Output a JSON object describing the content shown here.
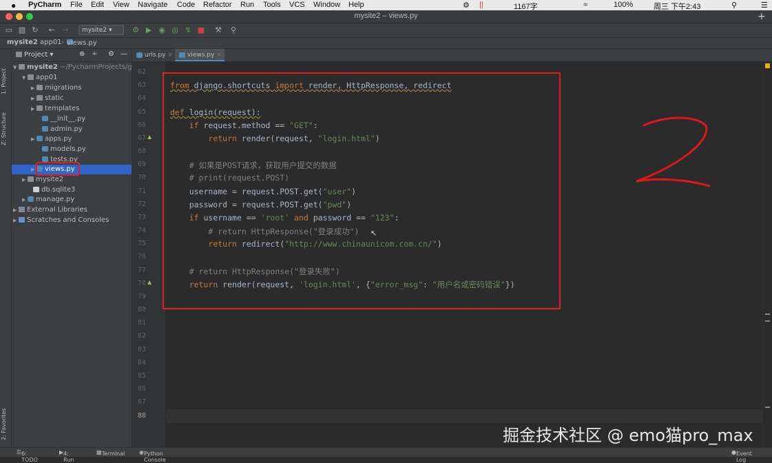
{
  "menubar": {
    "app_name": "PyCharm",
    "items": [
      "File",
      "Edit",
      "View",
      "Navigate",
      "Code",
      "Refactor",
      "Run",
      "Tools",
      "VCS",
      "Window",
      "Help"
    ],
    "status_text": "1167字",
    "battery": "100%",
    "datetime": "周三 下午2:43"
  },
  "window": {
    "title": "mysite2 – views.py"
  },
  "toolbar": {
    "run_config": "mysite2"
  },
  "breadcrumb": {
    "items": [
      "mysite2",
      "app01",
      "views.py"
    ]
  },
  "side_tabs": {
    "project": "1: Project",
    "structure": "Z: Structure",
    "favorites": "2: Favorites"
  },
  "project_panel": {
    "header": "Project",
    "tree": [
      {
        "label": "mysite2",
        "note": "~/PycharmProjects/g",
        "type": "folder",
        "expanded": true
      },
      {
        "label": "app01",
        "type": "folder",
        "expanded": true
      },
      {
        "label": "migrations",
        "type": "folder"
      },
      {
        "label": "static",
        "type": "folder"
      },
      {
        "label": "templates",
        "type": "folder"
      },
      {
        "label": "__init__.py",
        "type": "py"
      },
      {
        "label": "admin.py",
        "type": "py"
      },
      {
        "label": "apps.py",
        "type": "py"
      },
      {
        "label": "models.py",
        "type": "py"
      },
      {
        "label": "tests.py",
        "type": "py"
      },
      {
        "label": "views.py",
        "type": "py",
        "selected": true
      },
      {
        "label": "mysite2",
        "type": "folder"
      },
      {
        "label": "db.sqlite3",
        "type": "db"
      },
      {
        "label": "manage.py",
        "type": "py"
      },
      {
        "label": "External Libraries",
        "type": "lib"
      },
      {
        "label": "Scratches and Consoles",
        "type": "scratch"
      }
    ]
  },
  "tabs": [
    {
      "label": "urls.py",
      "active": false
    },
    {
      "label": "views.py",
      "active": true
    }
  ],
  "editor": {
    "line_numbers": [
      "62",
      "63",
      "64",
      "65",
      "66",
      "67",
      "68",
      "69",
      "70",
      "71",
      "72",
      "73",
      "74",
      "75",
      "76",
      "77",
      "78",
      "79",
      "80",
      "81",
      "82",
      "83",
      "84",
      "85",
      "86",
      "87",
      "88"
    ],
    "current_line": "88",
    "code": {
      "l63": [
        "from",
        " django.shortcuts ",
        "import",
        " render, HttpResponse, redirect"
      ],
      "l65": [
        "def",
        " login(request):"
      ],
      "l66": [
        "    ",
        "if",
        " request.method == ",
        "\"GET\"",
        ":"
      ],
      "l67": [
        "        ",
        "return",
        " render(request, ",
        "\"login.html\"",
        ")"
      ],
      "l69": "    # 如果是POST请求，获取用户提交的数据",
      "l70": "    # print(request.POST)",
      "l71": [
        "    username = request.POST.get(",
        "\"user\"",
        ")"
      ],
      "l72": [
        "    password = request.POST.get(",
        "\"pwd\"",
        ")"
      ],
      "l73": [
        "    ",
        "if",
        " username == ",
        "'root'",
        " ",
        "and",
        " password == ",
        "\"123\"",
        ":"
      ],
      "l74": "        # return HttpResponse(\"登录成功\")",
      "l75": [
        "        ",
        "return",
        " redirect(",
        "\"http://www.chinaunicom.com.cn/\"",
        ")"
      ],
      "l77": "    # return HttpResponse(\"登录失败\")",
      "l78": [
        "    ",
        "return",
        " render(request, ",
        "'login.html'",
        ", {",
        "\"error_msg\"",
        ": ",
        "\"用户名或密码错误\"",
        "})"
      ]
    }
  },
  "statusbar": {
    "todo": "6: TODO",
    "run": "4: Run",
    "terminal": "Terminal",
    "python_console": "Python Console",
    "event_log": "Event Log"
  },
  "watermark": "掘金技术社区 @ emo猫pro_max",
  "colors": {
    "keyword": "#cc7832",
    "string": "#6a8759",
    "comment": "#808080",
    "annotation_red": "#e02020",
    "selection": "#2f65ca"
  }
}
